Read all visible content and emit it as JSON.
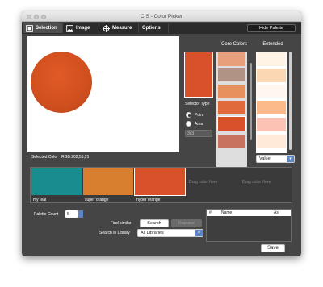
{
  "window": {
    "title": "CIS - Color Picker"
  },
  "toolbar": {
    "tabs": [
      {
        "label": "Selection",
        "icon": "selection-icon"
      },
      {
        "label": "Image",
        "icon": "image-icon"
      },
      {
        "label": "Measure",
        "icon": "crosshair-icon"
      },
      {
        "label": "Options"
      }
    ],
    "hide_palette_label": "Hide Palette"
  },
  "image_panel": {
    "selected_color_label": "Selected Color",
    "selected_color_value": "RGB:202,56,21",
    "circle_color": "#d8512a"
  },
  "selector": {
    "selected_swatch_color": "#d8512a",
    "type_label": "Selector Type",
    "point_label": "Point",
    "area_label": "Area",
    "area_size": "3x3",
    "selected_type": "Point"
  },
  "core_colors": {
    "header": "Core Colors",
    "swatches": [
      "#e8a07c",
      "#b09384",
      "#e8905e",
      "#e06a3c",
      "#d8512a",
      "#c87360"
    ],
    "selected_index": 4
  },
  "extended": {
    "header": "Extended",
    "swatches": [
      "#fff3e6",
      "#fcd7b4",
      "#fff7ef",
      "#fcb98a",
      "#fcc3b4",
      "#ffe9d8"
    ],
    "sort_value": "Value"
  },
  "palette": {
    "slots": [
      {
        "name": "my teal",
        "color": "#178d8f"
      },
      {
        "name": "super orange",
        "color": "#d87f2f"
      },
      {
        "name": "hyper orange",
        "color": "#d8512a"
      }
    ],
    "empty_slots": [
      "Drag color Here",
      "Drag color Here"
    ]
  },
  "controls": {
    "palette_count_label": "Palette Count",
    "palette_count_value": "5",
    "find_similar_label": "Find similar",
    "search_button": "Search",
    "replace_button": "Replace",
    "search_in_library_label": "Search in Library",
    "library_value": "All Libraries"
  },
  "results": {
    "columns": [
      "#",
      "Name",
      "As"
    ]
  },
  "footer": {
    "save_button": "Save"
  },
  "colors": {
    "window_bg": "#454545",
    "toolbar_bg": "#2b2b2b",
    "accent_blue": "#5d84c4"
  }
}
